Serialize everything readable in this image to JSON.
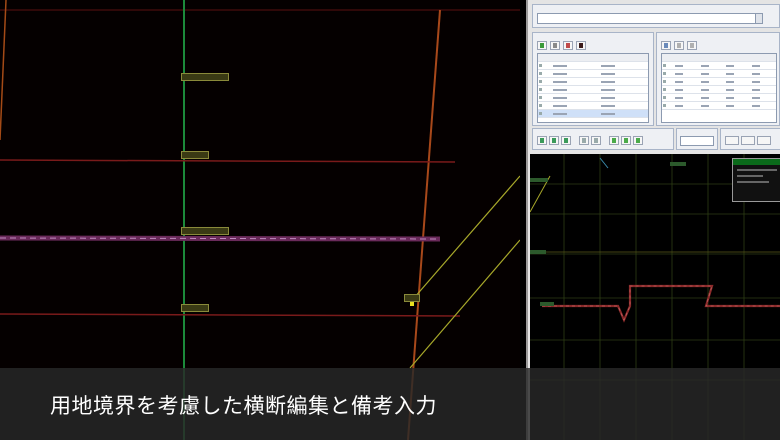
{
  "caption": {
    "text": "用地境界を考慮した横断編集と備考入力"
  },
  "colors": {
    "plan_background": "#050000",
    "centerline": "#1c8a3a",
    "boundary": "#7a1a1a",
    "road_edge": "#9a3a14",
    "guide_line": "#a8a82a",
    "section_ground": "#7a2a2a",
    "section_grid": "#3a4a1a",
    "caption_bar": "#282828"
  },
  "panel": {
    "selector_group": {
      "icon": "dropdown-group"
    },
    "left_grid": {
      "icon": "table-grid",
      "selected_row": 7
    },
    "right_grid": {
      "icon": "table-grid"
    },
    "view_toolbar": {
      "icon": "zoom-tools"
    }
  }
}
